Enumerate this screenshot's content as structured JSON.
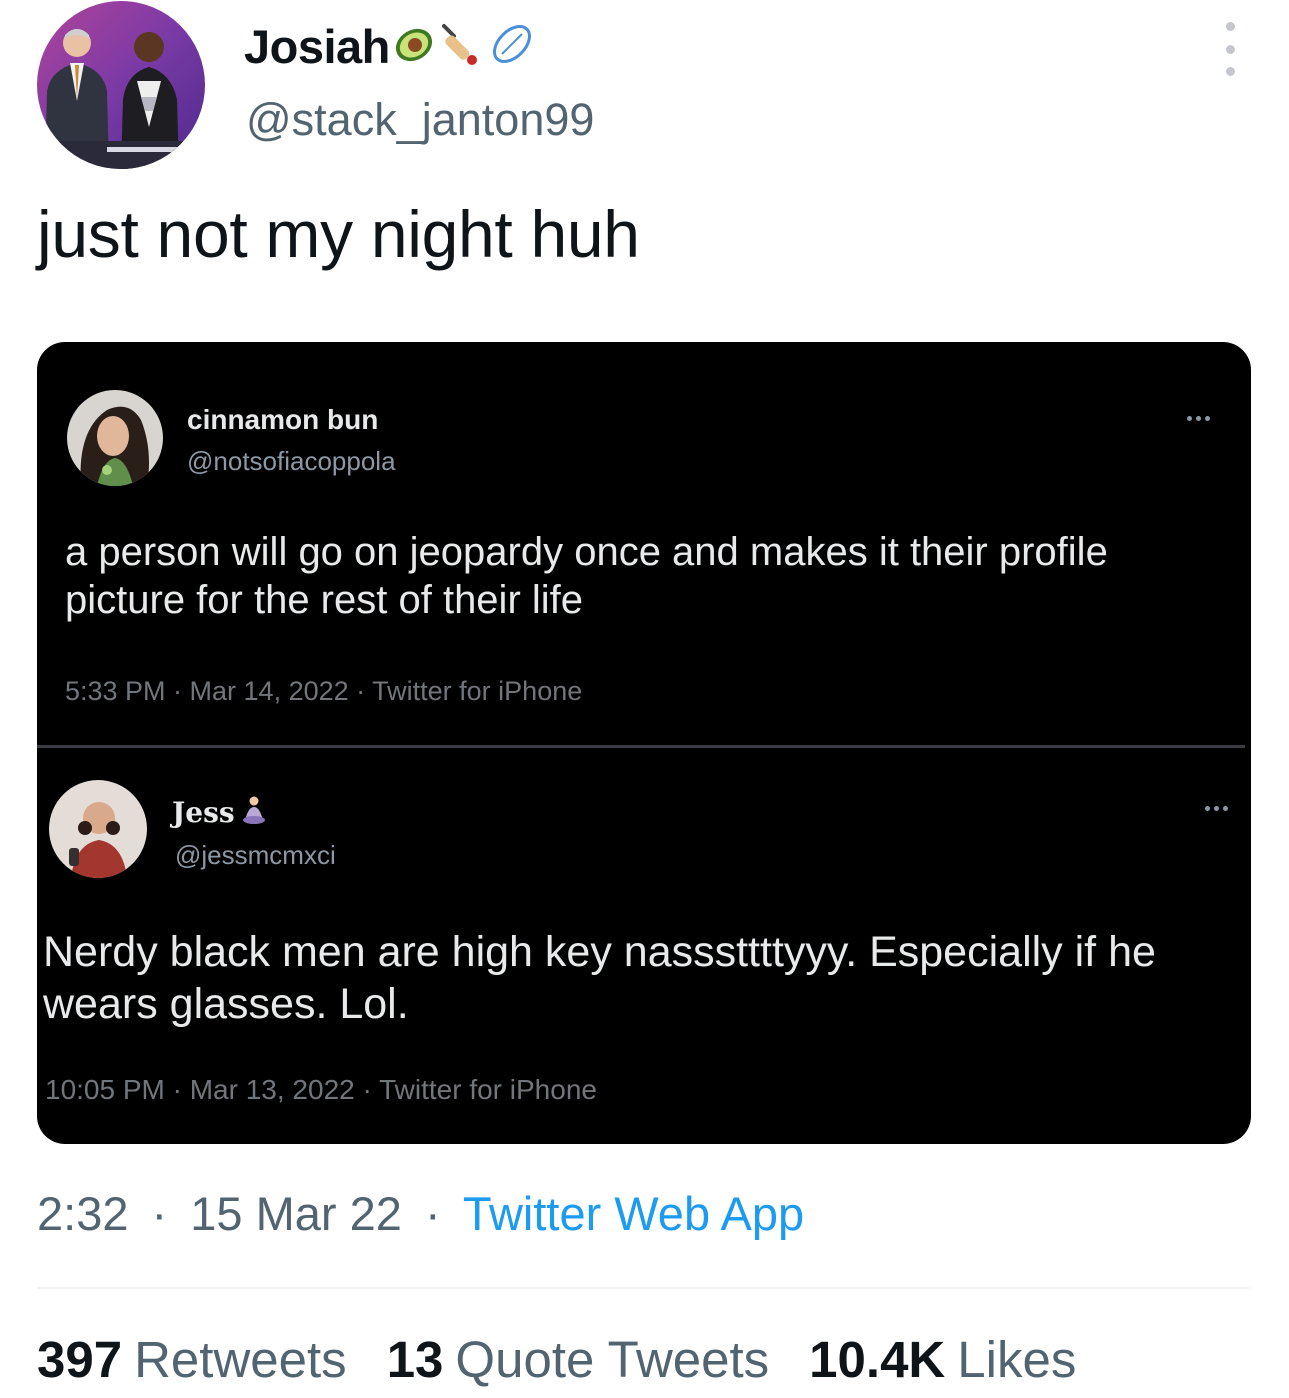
{
  "tweet": {
    "display_name": "Josiah",
    "name_emojis": [
      "avocado-emoji",
      "cricket-bat-emoji",
      "rugby-ball-emoji"
    ],
    "handle": "@stack_janton99",
    "text": "just not my night huh",
    "time": "2:32",
    "date": "15 Mar 22",
    "source": "Twitter Web App",
    "separator": "·",
    "stats": {
      "retweets": {
        "count": "397",
        "label": "Retweets"
      },
      "quotes": {
        "count": "13",
        "label": "Quote Tweets"
      },
      "likes": {
        "count": "10.4K",
        "label": "Likes"
      }
    }
  },
  "embedded_image": {
    "first": {
      "display_name": "cinnamon bun",
      "handle": "@notsofiacoppola",
      "text": "a person will go on jeopardy once and makes it their profile picture for the rest of their life",
      "meta": "5:33 PM · Mar 14, 2022 · Twitter for iPhone"
    },
    "second": {
      "display_name": "Jess",
      "name_emoji": "person-in-lotus-position-emoji",
      "handle": "@jessmcmxci",
      "text": "Nerdy black men are high key nasssttttyyy. Especially if he wears glasses. Lol.",
      "meta": "10:05 PM · Mar 13, 2022 · Twitter for iPhone"
    }
  },
  "colors": {
    "text_primary": "#0f1419",
    "text_secondary": "#536471",
    "link": "#1d9bf0",
    "card_background": "#000000"
  }
}
